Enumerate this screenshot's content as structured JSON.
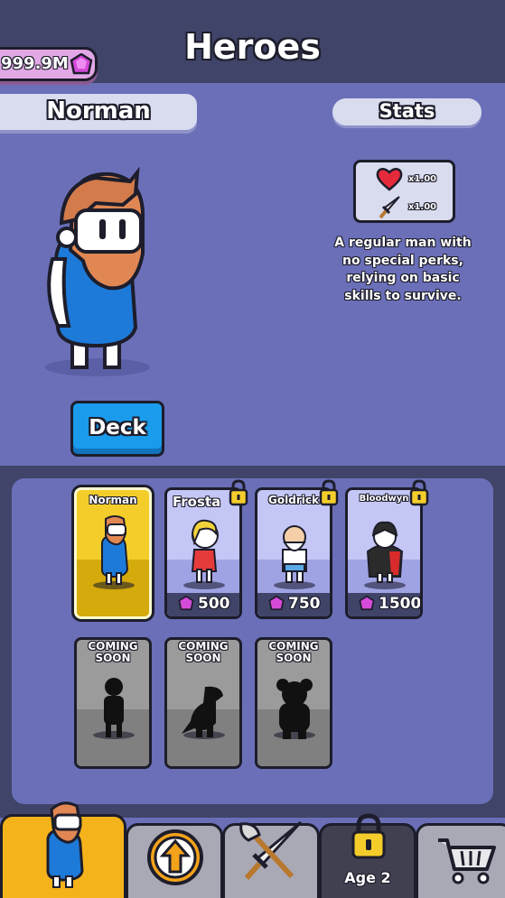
{
  "header": {
    "title": "Heroes",
    "currency": "999.9M"
  },
  "hero": {
    "name": "Norman",
    "stats_label": "Stats",
    "hp_multiplier": "x1.00",
    "attack_multiplier": "x1.00",
    "description": "A regular man with no special perks, relying on basic skills to survive."
  },
  "deck_button": {
    "label": "Deck"
  },
  "roster": {
    "heroes": [
      {
        "name": "Norman",
        "selected": true,
        "locked": false
      },
      {
        "name": "Frosta",
        "price": "500",
        "locked": true
      },
      {
        "name": "Goldrick",
        "price": "750",
        "locked": true
      },
      {
        "name": "Bloodwyn",
        "price": "1500",
        "locked": true
      }
    ],
    "coming_soon": [
      "COMING SOON",
      "COMING SOON",
      "COMING SOON"
    ]
  },
  "nav": {
    "tabs": [
      {
        "id": "heroes",
        "icon": "hero-portrait-icon",
        "active": true
      },
      {
        "id": "upgrades",
        "icon": "up-arrow-icon"
      },
      {
        "id": "battle",
        "icon": "crossed-weapons-icon"
      },
      {
        "id": "age",
        "icon": "lock-icon",
        "label": "Age 2"
      },
      {
        "id": "shop",
        "icon": "shopping-cart-icon"
      }
    ]
  },
  "colors": {
    "background": "#6a6fb8",
    "dark_panel": "#404468",
    "deck_blue": "#1a9bec",
    "selected_gold": "#f5cd2b",
    "gem_pink": "#d44ad9",
    "active_tab": "#f5b31b"
  }
}
